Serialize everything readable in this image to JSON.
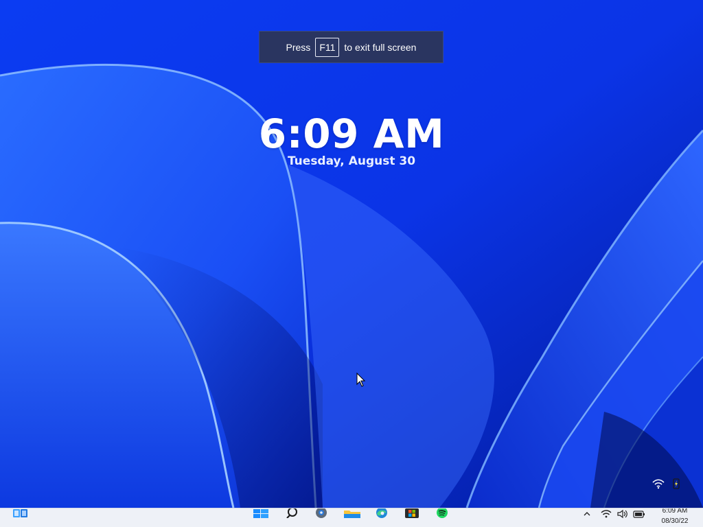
{
  "fullscreen_notice": {
    "press_label": "Press",
    "key_label": "F11",
    "suffix_label": "to exit full screen"
  },
  "lock_screen": {
    "time": "6:09 AM",
    "date": "Tuesday, August 30"
  },
  "taskbar": {
    "pinned": [
      {
        "name": "widgets-icon"
      },
      {
        "name": "start-icon"
      },
      {
        "name": "search-icon"
      },
      {
        "name": "settings-icon"
      },
      {
        "name": "file-explorer-icon"
      },
      {
        "name": "edge-icon"
      },
      {
        "name": "microsoft-store-icon"
      },
      {
        "name": "spotify-icon"
      }
    ],
    "tray": {
      "time": "6:09 AM",
      "date": "08/30/22"
    }
  },
  "colors": {
    "wallpaper_base": "#0a3ff0",
    "notice_bg": "#2a3560",
    "taskbar_bg": "#eef1f7",
    "spotify_green": "#1ed760",
    "windows_blue": "#1a8cff"
  }
}
